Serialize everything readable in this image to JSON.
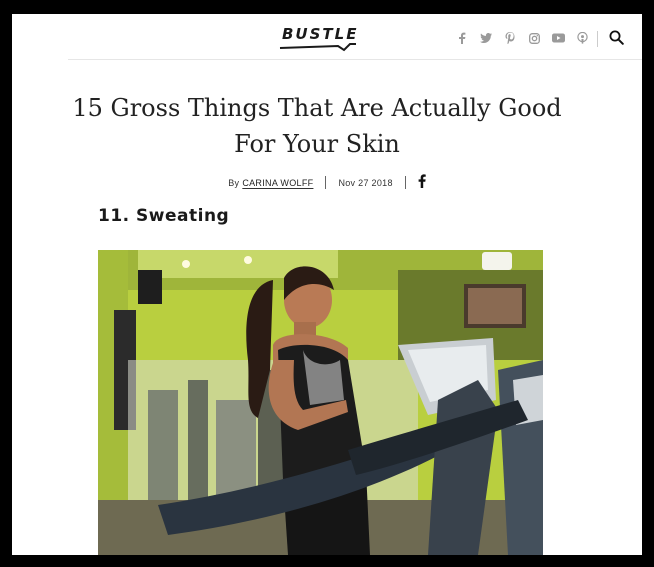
{
  "header": {
    "logo": "BUSTLE",
    "social_icons": [
      "facebook-icon",
      "twitter-icon",
      "pinterest-icon",
      "instagram-icon",
      "youtube-icon",
      "podcast-icon"
    ],
    "search_icon": "search-icon"
  },
  "article": {
    "title": "15 Gross Things That Are Actually Good For Your Skin",
    "byline_prefix": "By",
    "author": "CARINA WOLFF",
    "date": "Nov 27 2018",
    "share_icon": "facebook-icon"
  },
  "section": {
    "heading": "11. Sweating"
  },
  "colors": {
    "frame": "#000000",
    "page_bg": "#ffffff",
    "text": "#222222",
    "icon_gray": "#9a9a9a",
    "gym_wall_green": "#a8c63a"
  }
}
